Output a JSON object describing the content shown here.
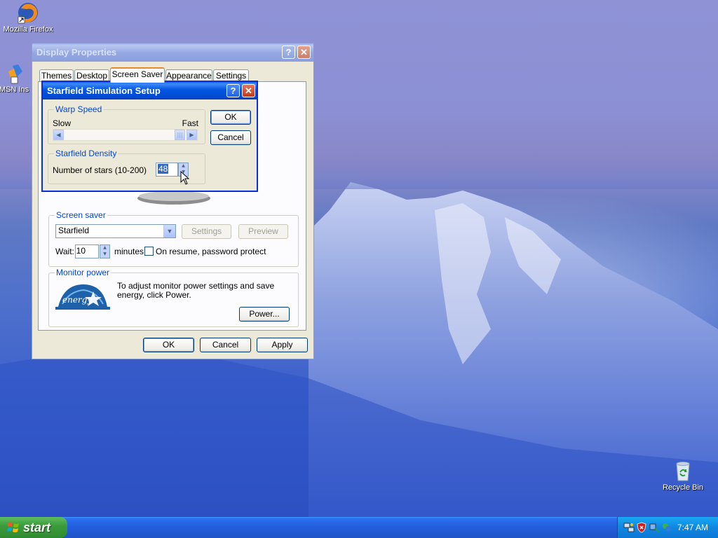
{
  "desktop": {
    "icons": [
      {
        "label": "Mozilla Firefox",
        "icon": "firefox-icon"
      },
      {
        "label": "MSN Ins",
        "icon": "msn-icon"
      },
      {
        "label": "Recycle Bin",
        "icon": "recycle-bin-icon"
      }
    ]
  },
  "display_properties": {
    "title": "Display Properties",
    "help_glyph": "?",
    "close_glyph": "✕",
    "tabs": [
      {
        "label": "Themes"
      },
      {
        "label": "Desktop"
      },
      {
        "label": "Screen Saver",
        "selected": true
      },
      {
        "label": "Appearance"
      },
      {
        "label": "Settings"
      }
    ],
    "screen_saver": {
      "group_title": "Screen saver",
      "selected": "Starfield",
      "settings_label": "Settings",
      "preview_label": "Preview",
      "wait_label": "Wait:",
      "wait_value": "10",
      "minutes_label": "minutes",
      "password_protect_label": "On resume, password protect",
      "password_protect_checked": false
    },
    "monitor_power": {
      "group_title": "Monitor power",
      "description": "To adjust monitor power settings and save energy, click Power.",
      "logo_text": "energy",
      "power_button": "Power..."
    },
    "buttons": {
      "ok": "OK",
      "cancel": "Cancel",
      "apply": "Apply"
    }
  },
  "starfield_setup": {
    "title": "Starfield Simulation Setup",
    "help_glyph": "?",
    "close_glyph": "✕",
    "warp_speed": {
      "group_title": "Warp Speed",
      "slow_label": "Slow",
      "fast_label": "Fast",
      "level": 1.0
    },
    "density": {
      "group_title": "Starfield Density",
      "label": "Number of stars (10-200)",
      "value": "48"
    },
    "buttons": {
      "ok": "OK",
      "cancel": "Cancel"
    }
  },
  "taskbar": {
    "start_label": "start",
    "clock": "7:47 AM",
    "tray_icons": [
      "network-icon",
      "security-shield-icon",
      "safely-remove-hardware-icon",
      "msn-tray-icon"
    ]
  },
  "colors": {
    "title_active": "#0054e3",
    "group_title": "#0046d5",
    "start_green": "#3c9d3c"
  }
}
